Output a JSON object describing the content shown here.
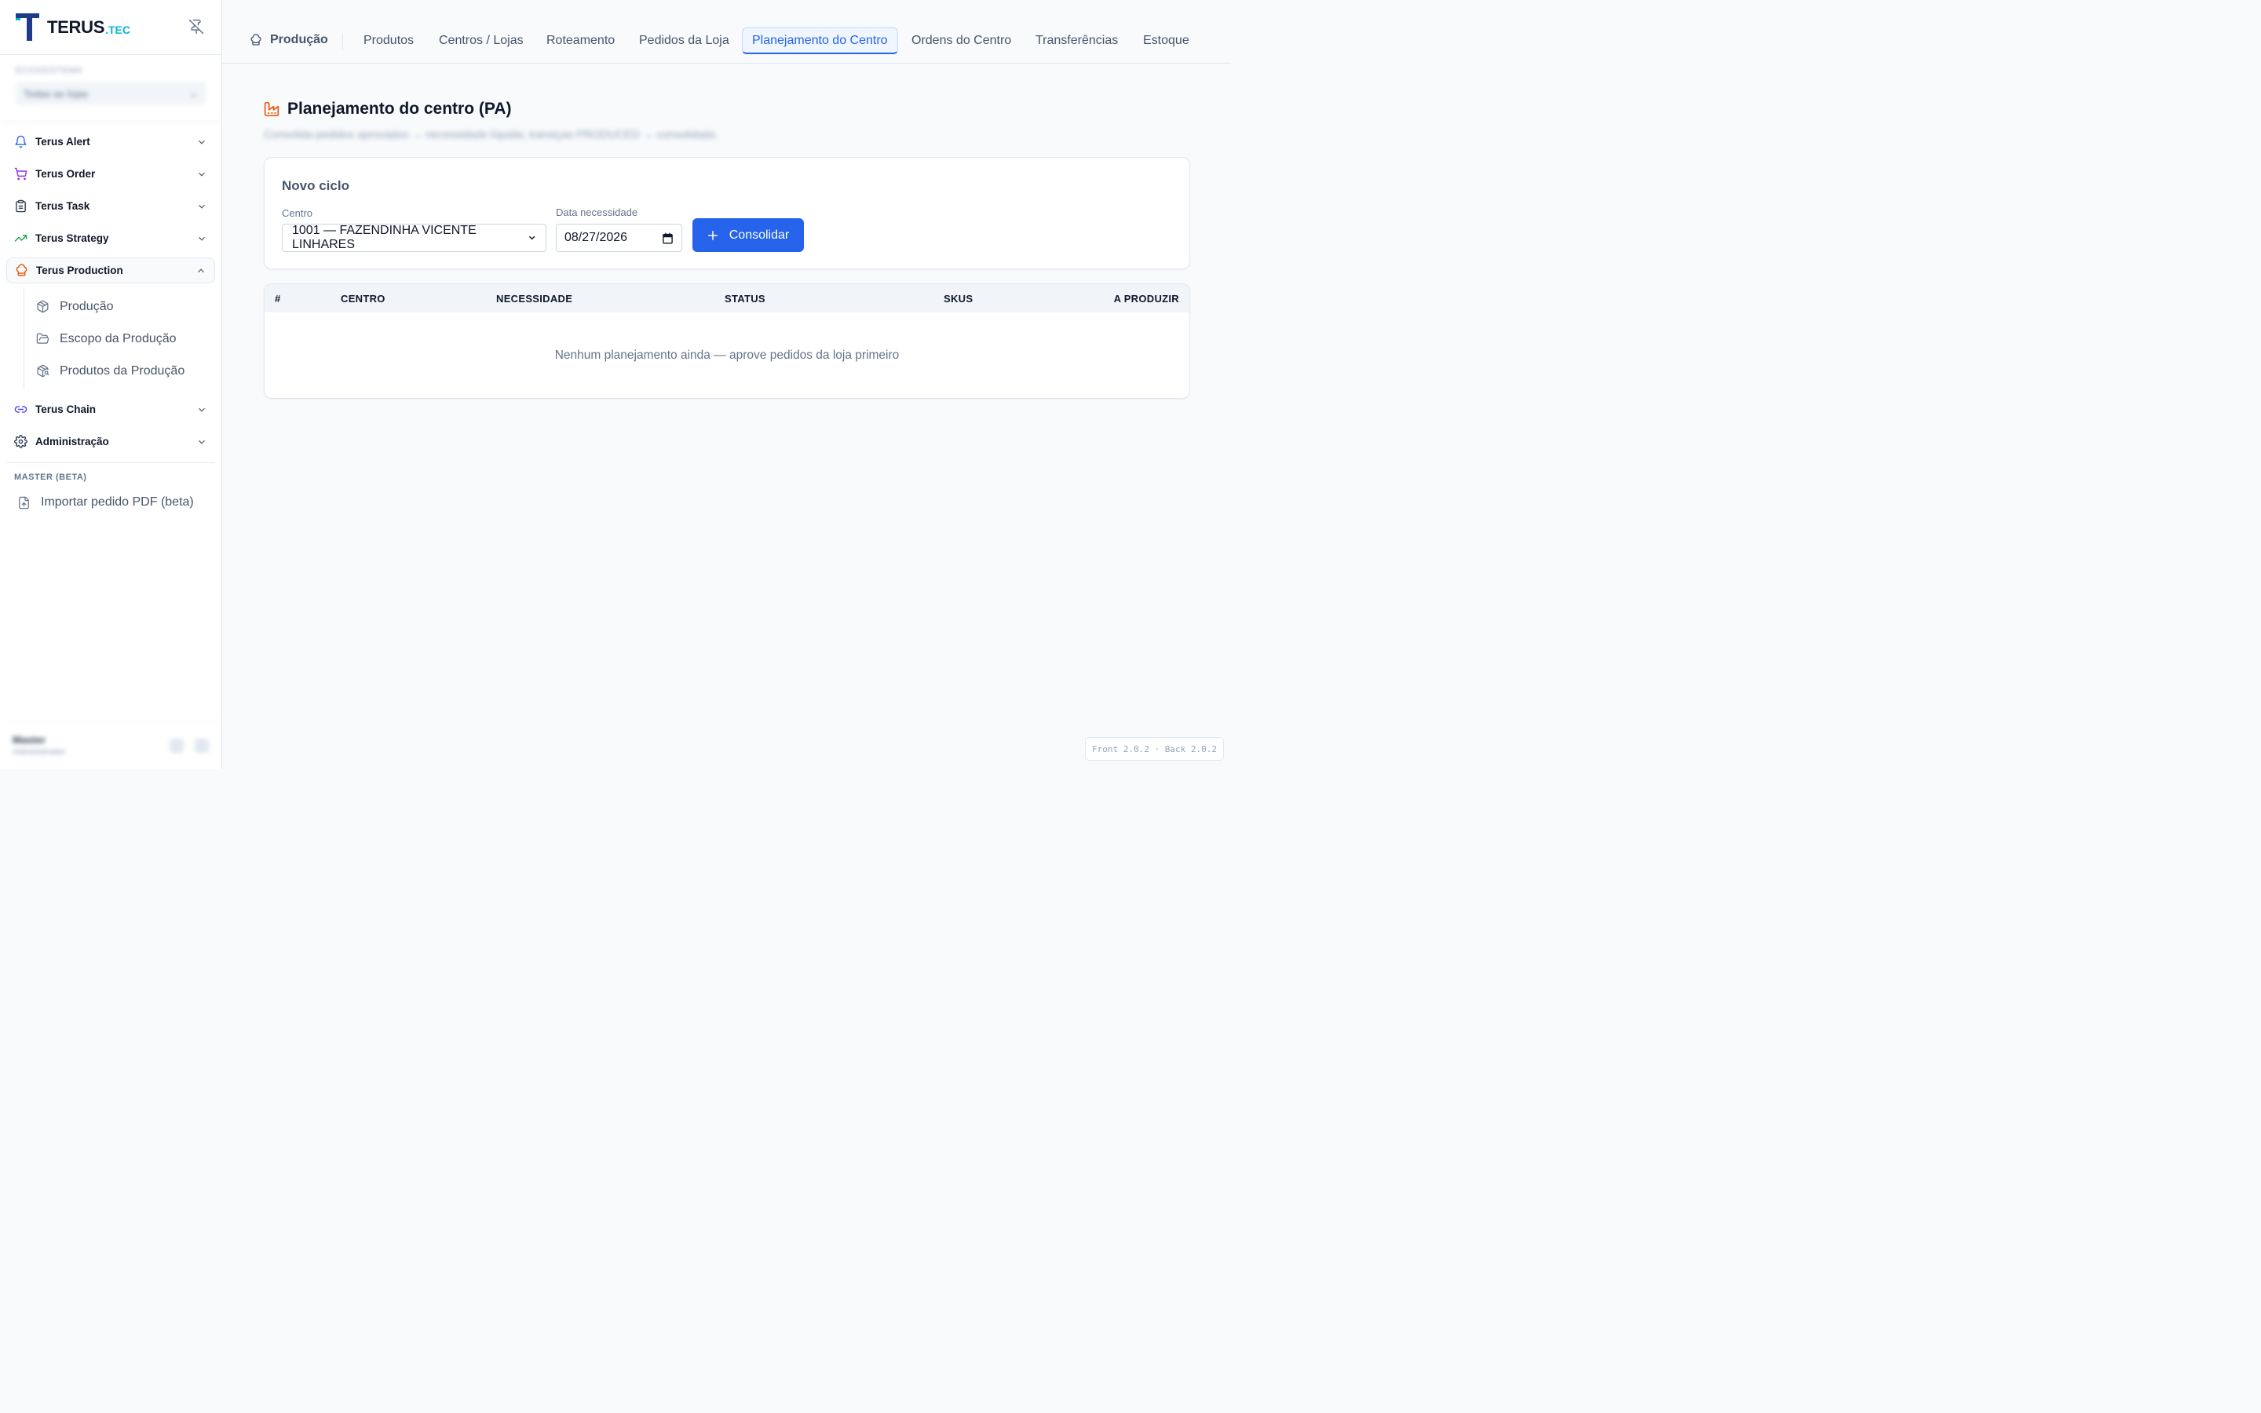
{
  "brand": {
    "name": "TERUS",
    "tld": ".TEC"
  },
  "environment": {
    "label": "Ecossistema",
    "value": "Todas as lojas"
  },
  "sidebar": {
    "items": [
      {
        "label": "Terus Alert",
        "icon": "bell-icon",
        "color": "#2563eb"
      },
      {
        "label": "Terus Order",
        "icon": "cart-icon",
        "color": "#9333ea"
      },
      {
        "label": "Terus Task",
        "icon": "clipboard-icon",
        "color": "#334155"
      },
      {
        "label": "Terus Strategy",
        "icon": "trending-up-icon",
        "color": "#16a34a"
      },
      {
        "label": "Terus Production",
        "icon": "chef-hat-icon",
        "color": "#ea580c"
      },
      {
        "label": "Terus Chain",
        "icon": "link-icon",
        "color": "#4f46e5"
      },
      {
        "label": "Administração",
        "icon": "gear-icon",
        "color": "#334155"
      }
    ],
    "production_sub": [
      {
        "label": "Produção",
        "icon": "box-icon"
      },
      {
        "label": "Escopo da Produção",
        "icon": "folder-open-icon"
      },
      {
        "label": "Produtos da Produção",
        "icon": "package-search-icon"
      }
    ],
    "master_section": "MASTER (BETA)",
    "master_item": "Importar pedido PDF (beta)"
  },
  "user": {
    "name": "Master",
    "role": "Administrador"
  },
  "topbar": {
    "module": "Produção",
    "tabs": [
      "Produtos",
      "Centros / Lojas",
      "Roteamento",
      "Pedidos da Loja",
      "Planejamento do Centro",
      "Ordens do Centro",
      "Transferências",
      "Estoque"
    ],
    "active_tab": "Planejamento do Centro"
  },
  "page": {
    "title": "Planejamento do centro (PA)",
    "subtitle": "Consolida pedidos aprovados → necessidade líquida; transiçao PRODUCED → consolidado."
  },
  "form": {
    "title": "Novo ciclo",
    "centro_label": "Centro",
    "centro_value": "1001 — FAZENDINHA VICENTE LINHARES",
    "data_label": "Data necessidade",
    "data_value": "08/27/2026",
    "button_label": "Consolidar"
  },
  "table": {
    "columns": [
      "#",
      "CENTRO",
      "NECESSIDADE",
      "STATUS",
      "SKUS",
      "A PRODUZIR"
    ],
    "rows": [],
    "empty_message": "Nenhum planejamento ainda — aprove pedidos da loja primeiro"
  },
  "version": "Front 2.0.2 · Back 2.0.2",
  "colors": {
    "accent": "#2563eb",
    "production": "#ea580c",
    "brand_cyan": "#06b6d4"
  }
}
